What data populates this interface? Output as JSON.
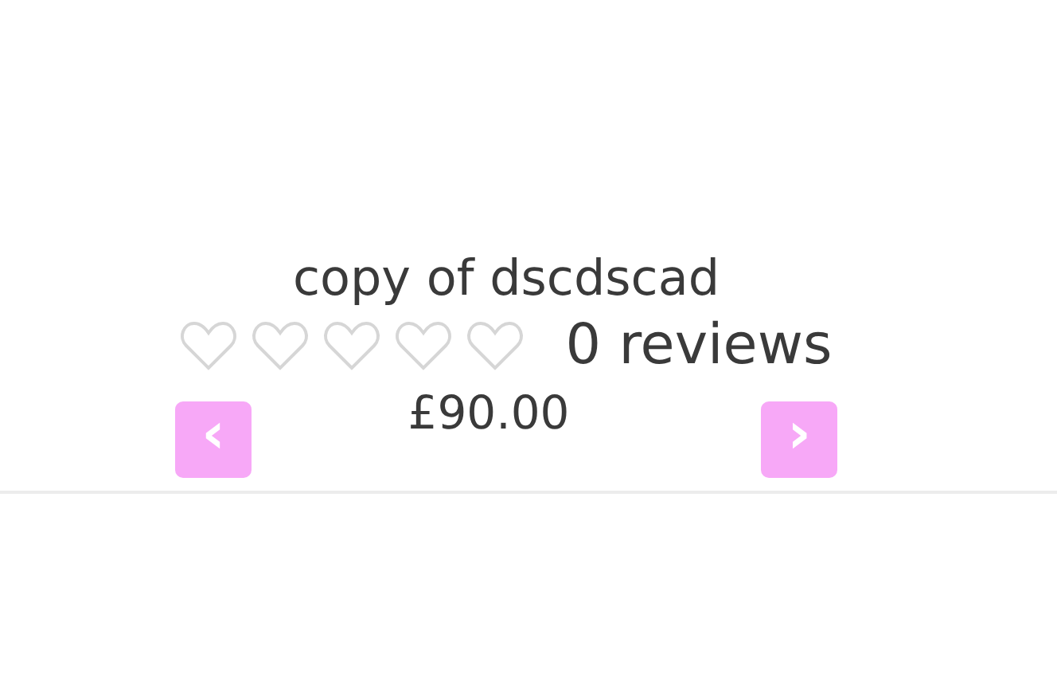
{
  "product": {
    "title": "copy of dscdscad",
    "rating": {
      "stars": 0,
      "reviews": "0 reviews"
    },
    "price": "£90.00"
  },
  "nav": {
    "prev": "‹",
    "next": "›"
  }
}
